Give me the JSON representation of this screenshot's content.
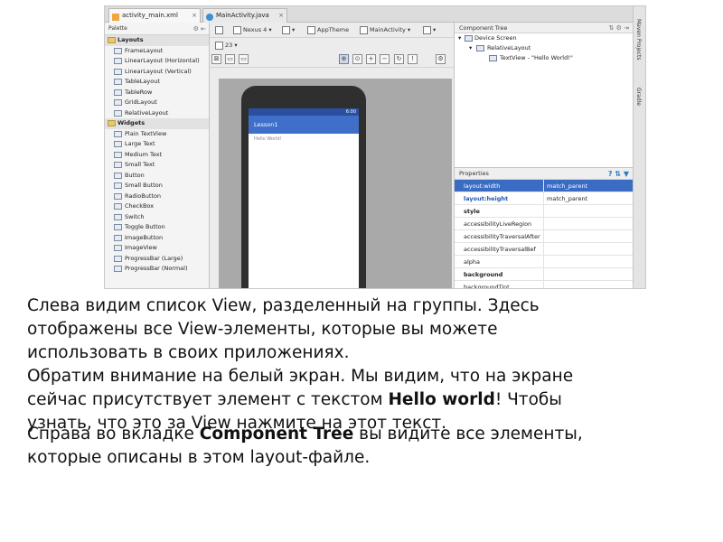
{
  "ide": {
    "tabs": [
      {
        "label": "activity_main.xml"
      },
      {
        "label": "MainActivity.java"
      }
    ],
    "palette": {
      "title": "Palette",
      "groups": [
        {
          "name": "Layouts",
          "items": [
            "FrameLayout",
            "LinearLayout (Horizontal)",
            "LinearLayout (Vertical)",
            "TableLayout",
            "TableRow",
            "GridLayout",
            "RelativeLayout"
          ]
        },
        {
          "name": "Widgets",
          "items": [
            "Plain TextView",
            "Large Text",
            "Medium Text",
            "Small Text",
            "Button",
            "Small Button",
            "RadioButton",
            "CheckBox",
            "Switch",
            "Toggle Button",
            "ImageButton",
            "ImageView",
            "ProgressBar (Large)",
            "ProgressBar (Normal)"
          ]
        }
      ]
    },
    "toolbar": {
      "api_level": "23",
      "device": "Nexus 4",
      "theme": "AppTheme",
      "activity": "MainActivity"
    },
    "preview": {
      "status_time": "6:00",
      "app_title": "Lesson1",
      "hello_text": "Hello World!"
    },
    "component_tree": {
      "title": "Component Tree",
      "nodes": [
        {
          "label": "Device Screen",
          "level": 0
        },
        {
          "label": "RelativeLayout",
          "level": 1
        },
        {
          "label": "TextView - \"Hello World!\"",
          "level": 2
        }
      ]
    },
    "properties": {
      "title": "Properties",
      "rows": [
        {
          "name": "layout:width",
          "value": "match_parent"
        },
        {
          "name": "layout:height",
          "value": "match_parent"
        },
        {
          "name": "style",
          "value": ""
        },
        {
          "name": "accessibilityLiveRegion",
          "value": ""
        },
        {
          "name": "accessibilityTraversalAfter",
          "value": ""
        },
        {
          "name": "accessibilityTraversalBef",
          "value": ""
        },
        {
          "name": "alpha",
          "value": ""
        },
        {
          "name": "background",
          "value": ""
        },
        {
          "name": "backgroundTint",
          "value": ""
        }
      ]
    },
    "side_tabs": [
      "Maven Projects",
      "Gradle"
    ]
  },
  "caption": {
    "line1": "Слева видим список View, разделенный на группы. Здесь",
    "line2": "отображены все View-элементы, которые вы можете",
    "line3": "использовать в своих приложениях.",
    "line4": "Обратим внимание на белый экран. Мы видим, что на экране",
    "line5_pre": "сейчас присутствует элемент с текстом ",
    "line5_bold": "Hello world",
    "line5_post": "! Чтобы",
    "line6": "узнать, что это за View нажмите на этот текст.",
    "line7_pre": "Справа во вкладке ",
    "line7_bold": "Component Tree",
    "line7_post": " вы видите все элементы,",
    "line8": "которые описаны в этом layout-файле."
  }
}
